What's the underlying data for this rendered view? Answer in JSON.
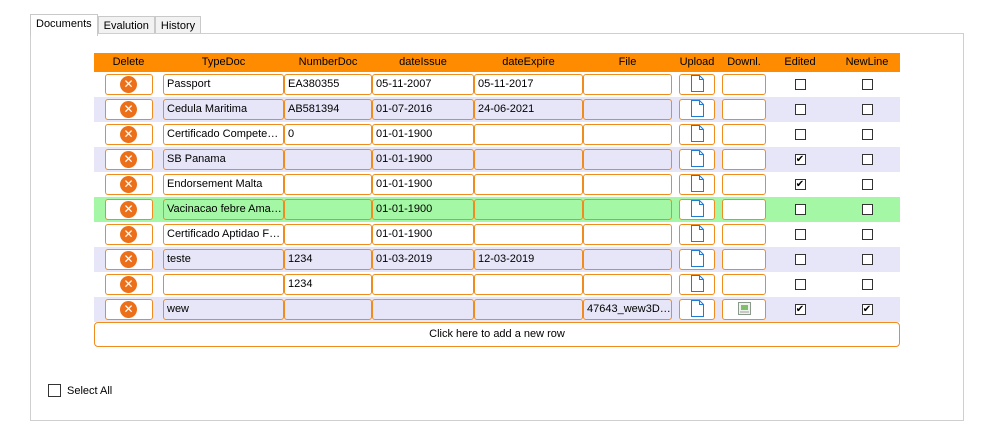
{
  "tabs": [
    "Documents",
    "Evalution",
    "History"
  ],
  "grid": {
    "columns": [
      "Delete",
      "TypeDoc",
      "NumberDoc",
      "dateIssue",
      "dateExpire",
      "File",
      "Upload",
      "Downl.",
      "Edited",
      "NewLine"
    ],
    "rows": [
      {
        "type": "Passport",
        "number": "EA380355",
        "issue": "05-11-2007",
        "expire": "05-11-2017",
        "file": "",
        "has_download": false,
        "edited": false,
        "newline": false,
        "style": "normal"
      },
      {
        "type": "Cedula Maritima",
        "number": "AB581394",
        "issue": "01-07-2016",
        "expire": "24-06-2021",
        "file": "",
        "has_download": false,
        "edited": false,
        "newline": false,
        "style": "alt"
      },
      {
        "type": "Certificado Compete…",
        "number": "0",
        "issue": "01-01-1900",
        "expire": "",
        "file": "",
        "has_download": false,
        "edited": false,
        "newline": false,
        "style": "normal"
      },
      {
        "type": "SB Panama",
        "number": "",
        "issue": "01-01-1900",
        "expire": "",
        "file": "",
        "has_download": false,
        "edited": true,
        "newline": false,
        "style": "alt"
      },
      {
        "type": "Endorsement Malta",
        "number": "",
        "issue": "01-01-1900",
        "expire": "",
        "file": "",
        "has_download": false,
        "edited": true,
        "newline": false,
        "style": "normal"
      },
      {
        "type": "Vacinacao febre Ama…",
        "number": "",
        "issue": "01-01-1900",
        "expire": "",
        "file": "",
        "has_download": false,
        "edited": false,
        "newline": false,
        "style": "highlight"
      },
      {
        "type": "Certificado Aptidao F…",
        "number": "",
        "issue": "01-01-1900",
        "expire": "",
        "file": "",
        "has_download": false,
        "edited": false,
        "newline": false,
        "style": "normal"
      },
      {
        "type": "teste",
        "number": "1234",
        "issue": "01-03-2019",
        "expire": "12-03-2019",
        "file": "",
        "has_download": false,
        "edited": false,
        "newline": false,
        "style": "alt"
      },
      {
        "type": "",
        "number": "1234",
        "issue": "",
        "expire": "",
        "file": "",
        "has_download": false,
        "edited": false,
        "newline": false,
        "style": "normal"
      },
      {
        "type": "wew",
        "number": "",
        "issue": "",
        "expire": "",
        "file": "47643_wew3D…",
        "has_download": true,
        "edited": true,
        "newline": true,
        "style": "alt"
      }
    ],
    "add_row_label": "Click here to add a new row"
  },
  "select_all_label": "Select All",
  "icons": {
    "delete": "close-circle-icon",
    "upload": "document-icon",
    "download": "download-file-icon",
    "check": "✔"
  },
  "colors": {
    "accent": "#ff8c00",
    "row_alt": "#e6e6f8",
    "row_highlight": "#a4f7a4",
    "delete_icon": "#ec6f1a"
  }
}
